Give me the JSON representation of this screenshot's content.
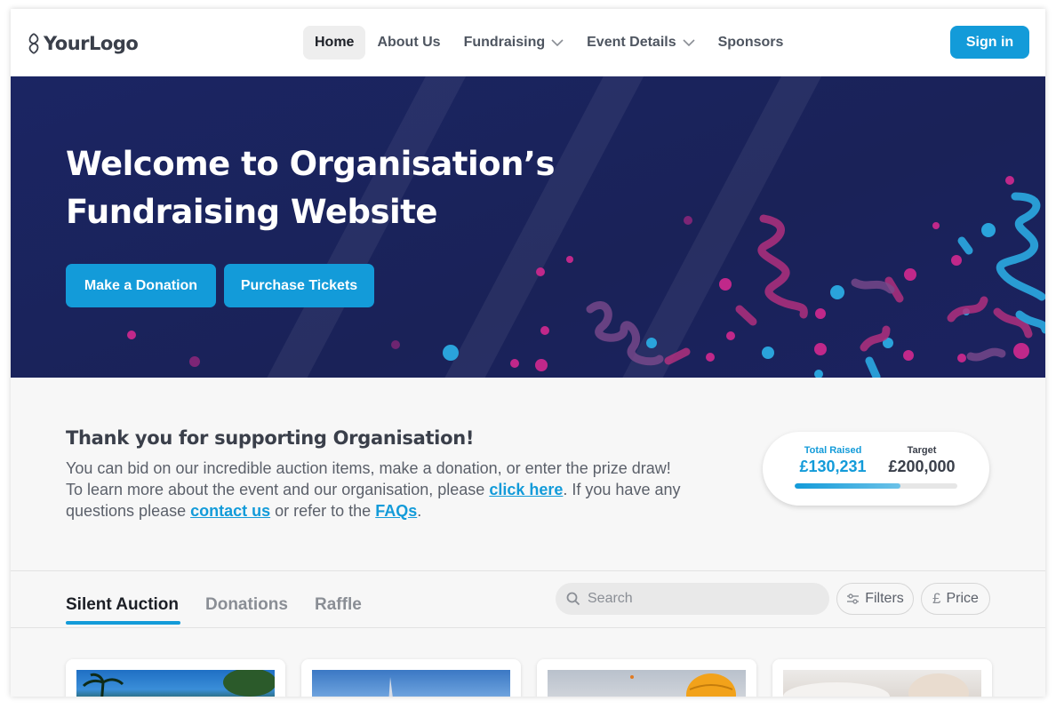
{
  "header": {
    "logo_text": "YourLogo",
    "nav": [
      {
        "label": "Home",
        "active": true
      },
      {
        "label": "About Us"
      },
      {
        "label": "Fundraising",
        "dropdown": true
      },
      {
        "label": "Event Details",
        "dropdown": true
      },
      {
        "label": "Sponsors"
      }
    ],
    "signin_label": "Sign in"
  },
  "hero": {
    "title_line1": "Welcome to Organisation’s",
    "title_line2": "Fundraising Website",
    "donate_label": "Make a Donation",
    "tickets_label": "Purchase Tickets"
  },
  "intro": {
    "title": "Thank you for supporting Organisation!",
    "line1": "You can bid on our incredible auction items, make a donation, or enter the prize draw!",
    "line2_pre": "To learn more about the event and our organisation, please ",
    "link_click_here": "click here",
    "line2_post": ". If you have any",
    "line3_pre": "questions please ",
    "link_contact": "contact us",
    "line3_mid": " or refer to the ",
    "link_faqs": "FAQs",
    "line3_post": "."
  },
  "raised": {
    "total_label": "Total Raised",
    "total_value": "£130,231",
    "target_label": "Target",
    "target_value": "£200,000",
    "progress_fraction": 0.65
  },
  "tabs": [
    {
      "label": "Silent Auction",
      "active": true
    },
    {
      "label": "Donations"
    },
    {
      "label": "Raffle"
    }
  ],
  "search": {
    "placeholder": "Search"
  },
  "filters_label": "Filters",
  "price_label": "Price",
  "colors": {
    "accent": "#139bd9",
    "hero_bg": "#1b2563",
    "confetti_pink": "#c0288a",
    "confetti_blue": "#2aa3db"
  },
  "icons": [
    "logo-mark-icon",
    "chevron-down-icon",
    "search-icon",
    "sliders-icon",
    "pound-icon"
  ]
}
